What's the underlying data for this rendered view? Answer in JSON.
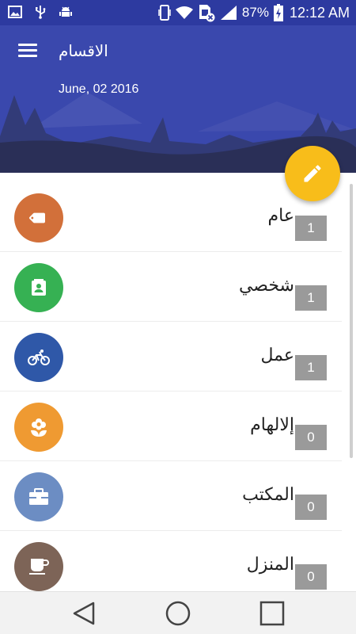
{
  "status_bar": {
    "battery_percent": "87%",
    "time": "12:12 AM",
    "left_icons": [
      "image-icon",
      "usb-icon",
      "android-debug-icon"
    ],
    "right_icons": [
      "vibrate-icon",
      "wifi-icon",
      "sim-no-data-icon",
      "signal-icon",
      "battery-charging-icon"
    ]
  },
  "header": {
    "title": "الاقسام",
    "date": "June, 02 2016",
    "menu_icon": "hamburger-menu-icon",
    "colors": {
      "sky": "#3a48ad",
      "mountains_dark": "#2a2f57",
      "mountains_mid": "#4754b3"
    }
  },
  "fab": {
    "icon": "edit-pencil-icon",
    "color": "#f8bd1a"
  },
  "categories": [
    {
      "name": "عام",
      "count": "1",
      "icon": "tag-icon",
      "color": "#d2703a"
    },
    {
      "name": "شخصي",
      "count": "1",
      "icon": "contact-icon",
      "color": "#36b153"
    },
    {
      "name": "عمل",
      "count": "1",
      "icon": "bicycle-icon",
      "color": "#2f58a8"
    },
    {
      "name": "إلالهام",
      "count": "0",
      "icon": "flower-icon",
      "color": "#ef9a32"
    },
    {
      "name": "المكتب",
      "count": "0",
      "icon": "briefcase-icon",
      "color": "#6c8dc3"
    },
    {
      "name": "المنزل",
      "count": "0",
      "icon": "coffee-cup-icon",
      "color": "#7d6457"
    }
  ],
  "nav_bar": {
    "buttons": [
      "back-icon",
      "home-icon",
      "recents-icon"
    ]
  }
}
